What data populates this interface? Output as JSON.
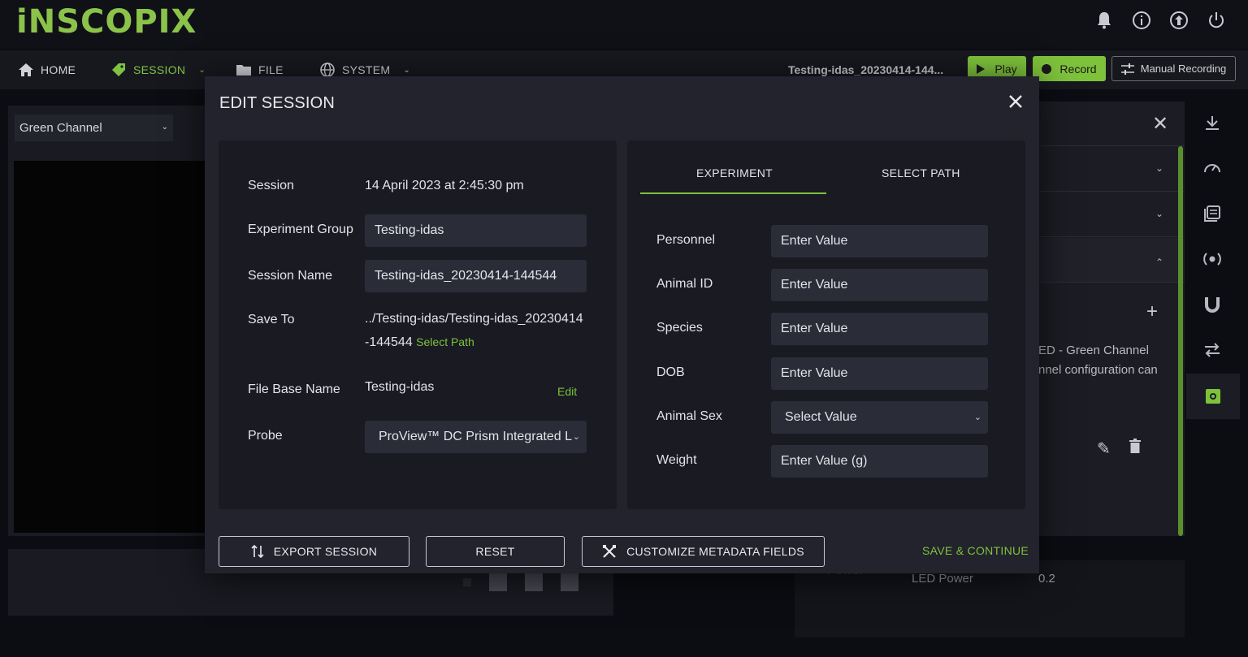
{
  "app": {
    "logo": "iNSCOPIX",
    "colors": {
      "accent": "#7ec23c",
      "background": "#0c0d12",
      "modal": "#22232d"
    }
  },
  "top_icons": [
    "bell-icon",
    "info-icon",
    "upload-icon",
    "power-icon"
  ],
  "nav": {
    "home": "HOME",
    "session": "SESSION",
    "file": "FILE",
    "system": "SYSTEM",
    "session_title": "Testing-idas_20230414-144...",
    "play": "Play",
    "record": "Record",
    "manual_recording": "Manual Recording"
  },
  "background": {
    "channel": "Green Channel",
    "panel_text_1": "ED - Green Channel",
    "panel_text_2": "nnel configuration can",
    "led_label": "LED Power",
    "led_value": "0.2",
    "power_label": "Power"
  },
  "modal": {
    "title": "EDIT SESSION",
    "fields": {
      "session_label": "Session",
      "session_value": "14 April 2023 at 2:45:30 pm",
      "group_label": "Experiment Group",
      "group_value": "Testing-idas",
      "name_label": "Session Name",
      "name_value": "Testing-idas_20230414-144544",
      "save_label": "Save To",
      "save_value_line1": "../Testing-idas/Testing-idas_20230414",
      "save_value_line2": "-144544",
      "select_path": "Select Path",
      "base_label": "File Base Name",
      "base_value": "Testing-idas",
      "edit": "Edit",
      "probe_label": "Probe",
      "probe_value": "ProView™ DC Prism Integrated L"
    },
    "tabs": [
      "EXPERIMENT",
      "SELECT PATH"
    ],
    "metadata": [
      {
        "label": "Personnel",
        "placeholder": "Enter Value"
      },
      {
        "label": "Animal ID",
        "placeholder": "Enter Value"
      },
      {
        "label": "Species",
        "placeholder": "Enter Value"
      },
      {
        "label": "DOB",
        "placeholder": "Enter Value"
      },
      {
        "label": "Animal Sex",
        "placeholder": "Select Value"
      },
      {
        "label": "Weight",
        "placeholder": "Enter Value (g)"
      }
    ],
    "buttons": {
      "export": "EXPORT SESSION",
      "reset": "RESET",
      "customize": "CUSTOMIZE METADATA FIELDS",
      "save": "SAVE & CONTINUE"
    }
  }
}
